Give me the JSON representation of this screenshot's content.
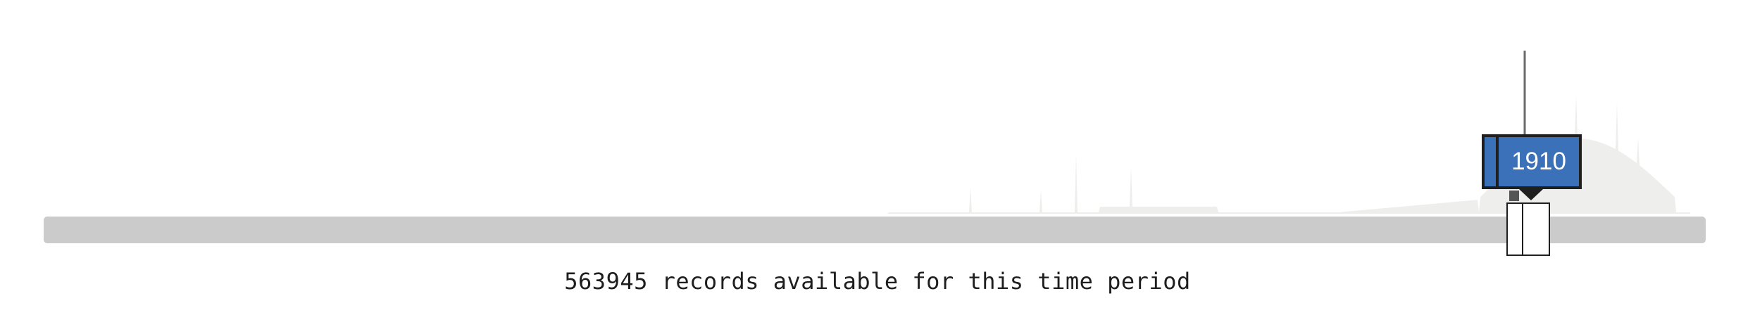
{
  "timeline": {
    "selected_year": "1910",
    "records_count": "563945",
    "records_text": "563945 records available for this time period"
  },
  "colors": {
    "histogram": "#eeeeec",
    "track": "#cbcbcb",
    "tooltip": "#3a71b8",
    "outline": "#1f1f1f"
  },
  "icons": {
    "handle": "range-handle-icon"
  }
}
